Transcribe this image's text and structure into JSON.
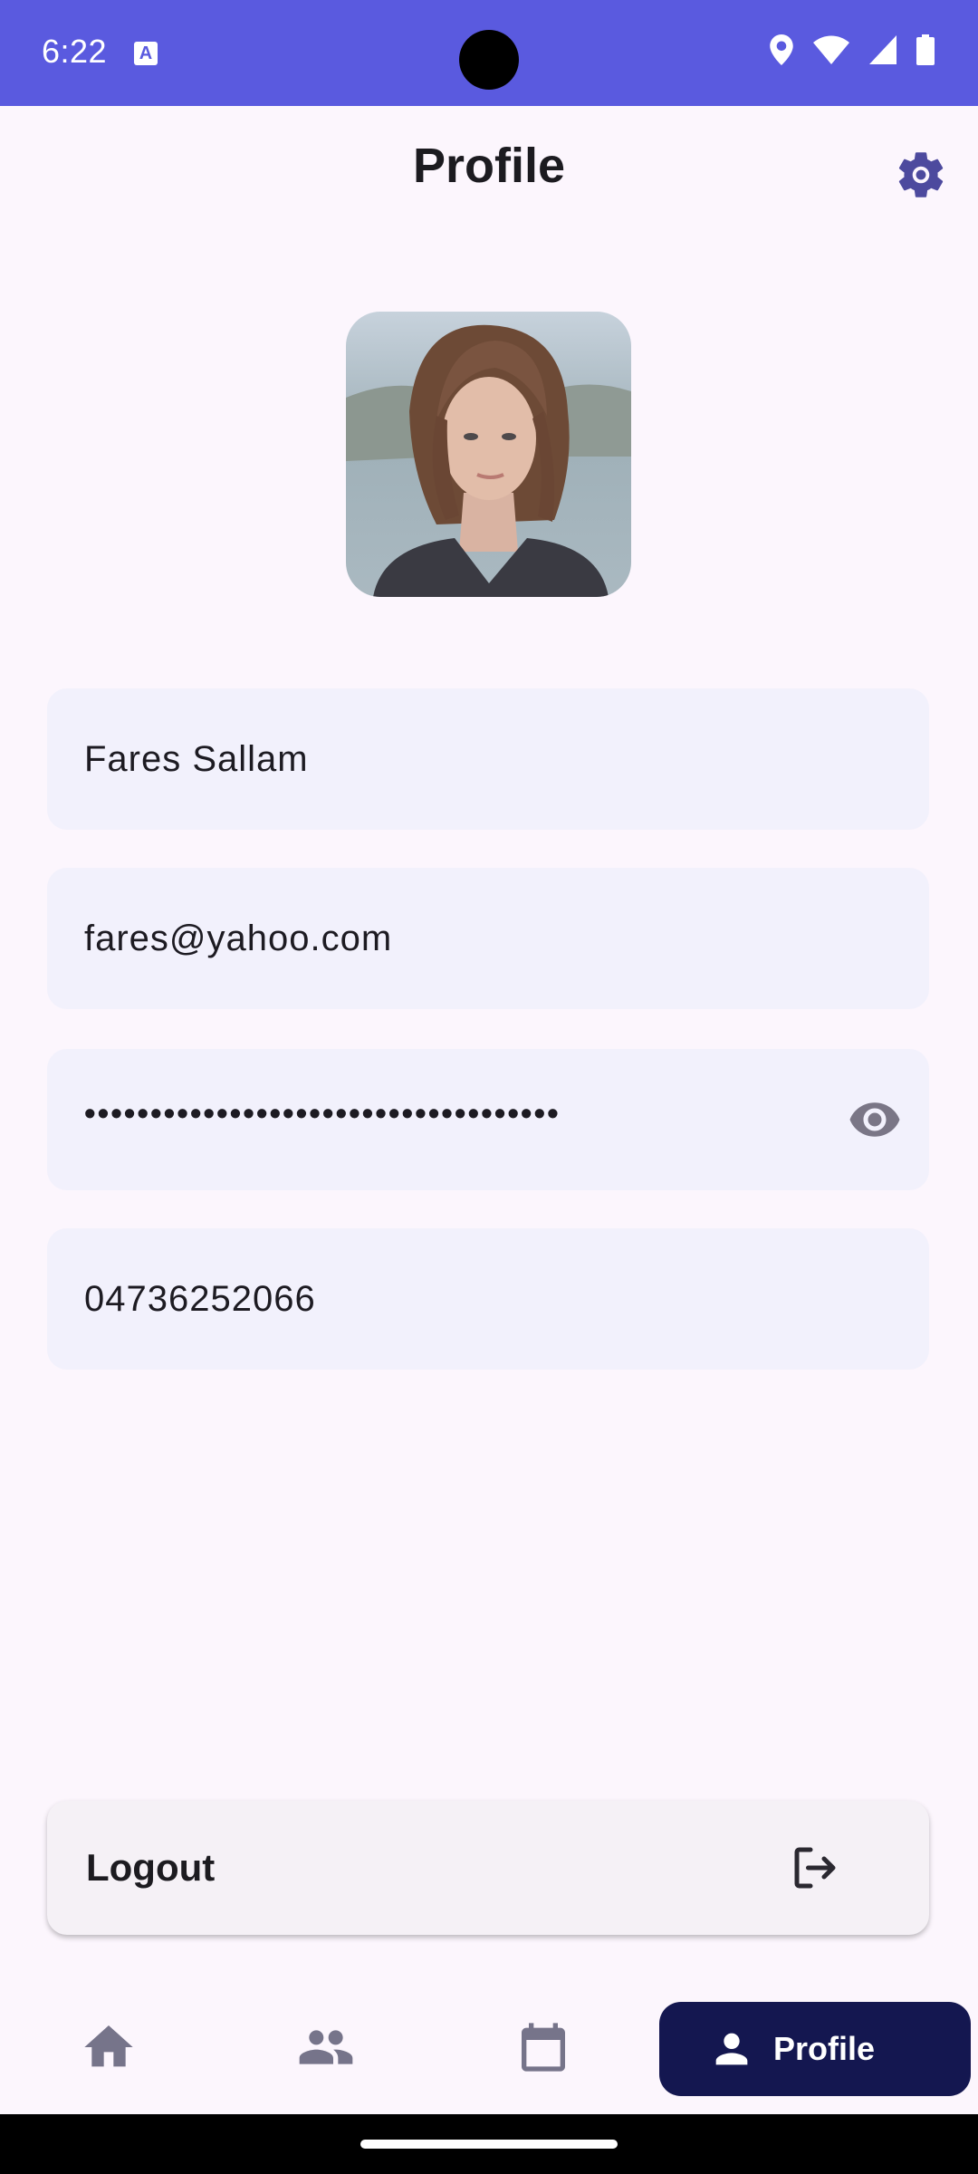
{
  "status_bar": {
    "time": "6:22",
    "notification_icon": "a-icon",
    "icons": [
      "location-icon",
      "wifi-icon",
      "signal-icon",
      "battery-icon"
    ]
  },
  "header": {
    "title": "Profile",
    "settings_icon": "gear-icon"
  },
  "colors": {
    "accent": "#5a5adf",
    "field_background": "#f2f1fc",
    "nav_active": "#141750",
    "page_background": "#fcf6fd"
  },
  "profile": {
    "avatar": "profile-photo",
    "name": "Fares Sallam",
    "email": "fares@yahoo.com",
    "password": "••••••••••••••••••••••••••••••••••••",
    "phone": "04736252066"
  },
  "logout": {
    "label": "Logout",
    "icon": "logout-icon"
  },
  "bottom_nav": {
    "items": [
      {
        "icon": "home-icon"
      },
      {
        "icon": "people-icon"
      },
      {
        "icon": "calendar-icon"
      },
      {
        "icon": "person-icon",
        "label": "Profile",
        "active": true
      }
    ]
  }
}
